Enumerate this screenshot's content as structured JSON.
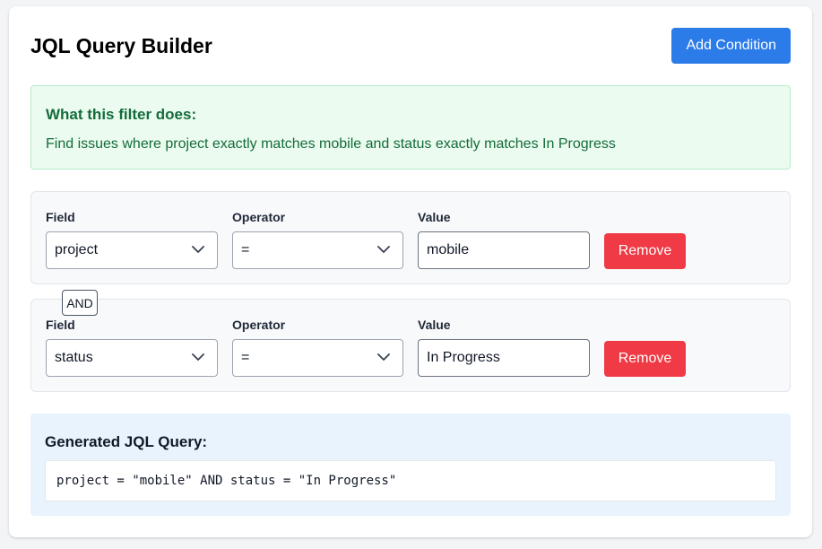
{
  "header": {
    "title": "JQL Query Builder",
    "add_label": "Add Condition"
  },
  "explanation": {
    "title": "What this filter does:",
    "text": "Find issues where project exactly matches mobile and status exactly matches In Progress"
  },
  "labels": {
    "field": "Field",
    "operator": "Operator",
    "value": "Value",
    "remove": "Remove"
  },
  "conditions": [
    {
      "field": "project",
      "operator": "=",
      "value": "mobile"
    },
    {
      "field": "status",
      "operator": "=",
      "value": "In Progress"
    }
  ],
  "joiner": "AND",
  "query": {
    "title": "Generated JQL Query:",
    "text": "project = \"mobile\" AND status = \"In Progress\""
  },
  "colors": {
    "primary": "#2b7be8",
    "danger": "#f03a45",
    "success_bg": "#ebfbf0",
    "success_text": "#146c3b",
    "query_bg": "#e9f3fd"
  },
  "icons": {
    "select_arrow": "chevron-down-icon"
  }
}
